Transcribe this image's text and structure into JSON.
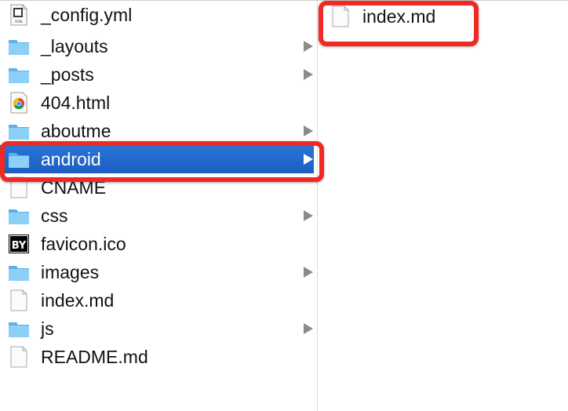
{
  "left_column": {
    "items": [
      {
        "label": "_config.yml",
        "icon": "yaml-file-icon",
        "folder": false
      },
      {
        "label": "_layouts",
        "icon": "folder-icon",
        "folder": true
      },
      {
        "label": "_posts",
        "icon": "folder-icon",
        "folder": true
      },
      {
        "label": "404.html",
        "icon": "chrome-html-file-icon",
        "folder": false
      },
      {
        "label": "aboutme",
        "icon": "folder-icon",
        "folder": true
      },
      {
        "label": "android",
        "icon": "folder-icon",
        "folder": true,
        "selected": true
      },
      {
        "label": "CNAME",
        "icon": "document-icon",
        "folder": false
      },
      {
        "label": "css",
        "icon": "folder-icon",
        "folder": true
      },
      {
        "label": "favicon.ico",
        "icon": "favicon-by-icon",
        "folder": false,
        "icon_text": "BY"
      },
      {
        "label": "images",
        "icon": "folder-icon",
        "folder": true
      },
      {
        "label": "index.md",
        "icon": "document-icon",
        "folder": false
      },
      {
        "label": "js",
        "icon": "folder-icon",
        "folder": true
      },
      {
        "label": "README.md",
        "icon": "document-icon",
        "folder": false
      }
    ]
  },
  "right_column": {
    "items": [
      {
        "label": "index.md",
        "icon": "document-icon"
      }
    ]
  },
  "colors": {
    "selection": "#1b5fc4",
    "annotation": "#ee2a22",
    "folder": "#7cc3f2"
  }
}
